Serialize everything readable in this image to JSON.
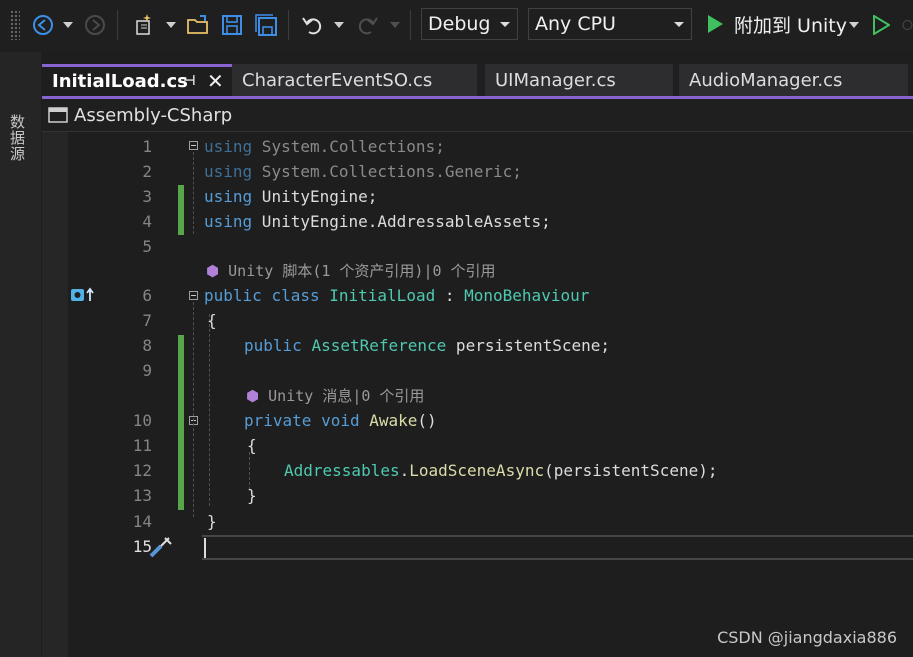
{
  "toolbar": {
    "config_value": "Debug",
    "platform_value": "Any CPU",
    "run_label": "附加到 Unity"
  },
  "sidebar": {
    "label": "数据源"
  },
  "tabs": [
    {
      "label": "InitialLoad.cs",
      "active": true
    },
    {
      "label": "CharacterEventSO.cs"
    },
    {
      "label": "UIManager.cs"
    },
    {
      "label": "AudioManager.cs"
    }
  ],
  "navbar": {
    "project": "Assembly-CSharp"
  },
  "editor": {
    "line_numbers": [
      "1",
      "2",
      "3",
      "4",
      "5",
      "6",
      "7",
      "8",
      "9",
      "10",
      "11",
      "12",
      "13",
      "14",
      "15"
    ],
    "codelens": {
      "class": "Unity 脚本(1 个资产引用)|0 个引用",
      "method": "Unity 消息|0 个引用"
    },
    "code": {
      "l1_kw": "using",
      "l1_rest": " System.Collections;",
      "l2_kw": "using",
      "l2_rest": " System.Collections.Generic;",
      "l3_kw": "using",
      "l3_rest": " UnityEngine;",
      "l4_kw": "using",
      "l4_rest": " UnityEngine.AddressableAssets;",
      "l6_kw1": "public",
      "l6_kw2": "class",
      "l6_name": "InitialLoad",
      "l6_colon": " : ",
      "l6_base": "MonoBehaviour",
      "l7": "{",
      "l8_kw": "public",
      "l8_type": "AssetReference",
      "l8_rest": " persistentScene;",
      "l10_kw1": "private",
      "l10_kw2": "void",
      "l10_name": "Awake",
      "l10_rest": "()",
      "l11": "{",
      "l12_type": "Addressables",
      "l12_dot": ".",
      "l12_meth": "LoadSceneAsync",
      "l12_rest": "(persistentScene);",
      "l13": "}",
      "l14": "}"
    }
  },
  "watermark": "CSDN @jiangdaxia886",
  "colors": {
    "accent": "#8a63d2",
    "keyword": "#569cd6",
    "type": "#4ec9b0",
    "method": "#dcdcaa",
    "change_bar": "#57a64a"
  }
}
